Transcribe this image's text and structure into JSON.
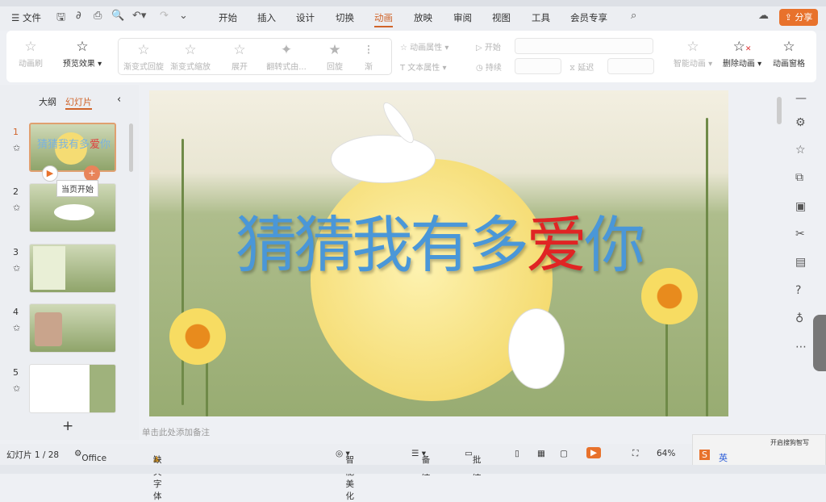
{
  "menu": {
    "file": "文件",
    "tabs": [
      "开始",
      "插入",
      "设计",
      "切换",
      "动画",
      "放映",
      "审阅",
      "视图",
      "工具",
      "会员专享"
    ],
    "active": "动画",
    "share": "分享"
  },
  "ribbon": {
    "painter": "动画刷",
    "preview": "预览效果",
    "gallery": [
      "渐变式回旋",
      "渐变式缩放",
      "展开",
      "翻转式由...",
      "回旋",
      "渐"
    ],
    "anim_props": "动画属性",
    "text_props": "文本属性",
    "start": "开始",
    "duration": "持续",
    "delay": "延迟",
    "smart": "智能动画",
    "delete": "删除动画",
    "pane": "动画窗格"
  },
  "left": {
    "tab_outline": "大纲",
    "tab_slides": "幻灯片",
    "tooltip": "当页开始",
    "slides": [
      "1",
      "2",
      "3",
      "4",
      "5"
    ]
  },
  "slide": {
    "title_part1": "猜猜我有多",
    "title_red": "爱",
    "title_part2": "你"
  },
  "notes": "单击此处添加备注",
  "status": {
    "slide": "幻灯片 1 / 28",
    "theme": "Office 主题",
    "font": "缺失字体",
    "beautify": "智能美化",
    "notes": "备注",
    "comment": "批注",
    "zoom": "64%"
  },
  "ime": {
    "tip": "开启搜狗智写",
    "lang": "英"
  }
}
